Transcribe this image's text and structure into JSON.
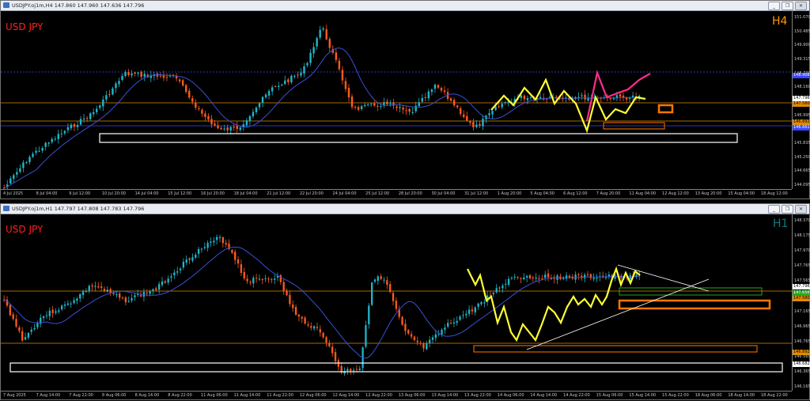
{
  "colors": {
    "bull": "#1fb6c9",
    "bear": "#ff5a1f",
    "ma": "#3b4fd6",
    "yellow": "#ffff33",
    "pink": "#ff2d8c",
    "orange": "#ff7700",
    "green": "#22aa22",
    "white": "#ffffff",
    "hline": "#e08a00",
    "blueline": "#3848ff"
  },
  "top": {
    "title": "USDJPY.oj1m,H4 147.860 147.960 147.636 147.796",
    "symbol_label": "USD JPY",
    "timeframe": "H4",
    "price_ticks": [
      "151.070",
      "150.485",
      "149.900",
      "149.315",
      "148.730",
      "148.160",
      "147.580",
      "146.995",
      "146.410",
      "145.835",
      "145.250",
      "144.665",
      "144.095"
    ],
    "price_labels": {
      "blue": "148.908",
      "current": "147.796",
      "orange": "147.580",
      "orange2": "146.892",
      "blue2": "146.661"
    },
    "time_ticks": [
      "4 Jul 2025",
      "8 Jul 04:00",
      "9 Jul 12:00",
      "10 Jul 20:00",
      "14 Jul 04:00",
      "15 Jul 12:00",
      "16 Jul 20:00",
      "18 Jul 04:00",
      "21 Jul 12:00",
      "22 Jul 20:00",
      "24 Jul 04:00",
      "25 Jul 12:00",
      "28 Jul 20:00",
      "30 Jul 04:00",
      "31 Jul 12:00",
      "1 Aug 20:00",
      "5 Aug 04:00",
      "6 Aug 12:00",
      "7 Aug 20:00",
      "11 Aug 04:00",
      "12 Aug 12:00",
      "13 Aug 20:00",
      "15 Aug 04:00",
      "18 Aug 12:00"
    ]
  },
  "bottom": {
    "title": "USDJPY.oj1m,H1 147.797 147.808 147.783 147.796",
    "symbol_label": "USD JPY",
    "timeframe": "H1",
    "price_ticks": [
      "148.370",
      "148.175",
      "147.970",
      "147.765",
      "147.565",
      "147.365",
      "147.165",
      "146.965",
      "146.765",
      "146.565",
      "146.365",
      "146.165"
    ],
    "price_labels": {
      "current": "147.796",
      "green": "147.656",
      "orange": "147.580",
      "orange2": "146.892",
      "white": "146.682"
    },
    "time_ticks": [
      "7 Aug 2025",
      "7 Aug 14:00",
      "7 Aug 22:00",
      "8 Aug 06:00",
      "8 Aug 14:00",
      "8 Aug 22:00",
      "11 Aug 06:00",
      "11 Aug 14:00",
      "11 Aug 22:00",
      "12 Aug 06:00",
      "12 Aug 14:00",
      "12 Aug 22:00",
      "13 Aug 06:00",
      "13 Aug 14:00",
      "13 Aug 22:00",
      "14 Aug 06:00",
      "14 Aug 14:00",
      "14 Aug 22:00",
      "15 Aug 06:00",
      "15 Aug 14:00",
      "15 Aug 22:00",
      "18 Aug 06:00",
      "18 Aug 14:00",
      "18 Aug 22:00"
    ]
  },
  "window_controls": {
    "minimize": "_",
    "restore": "❐",
    "close": "✕"
  }
}
